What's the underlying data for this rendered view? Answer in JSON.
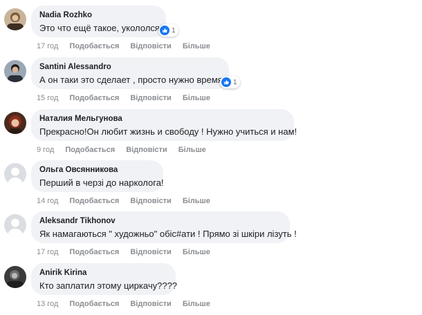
{
  "actions": {
    "like": "Подобається",
    "reply": "Відповісти",
    "more": "Більше"
  },
  "colors": {
    "bubble": "#f0f2f5",
    "like_badge": "#1877f2",
    "meta_text": "#8a8d91"
  },
  "comments": [
    {
      "author": "Nadia Rozhko",
      "text": "Это что ещё такое, укололся?",
      "time": "17 год",
      "reactions": {
        "icon": "like-icon",
        "count": "1"
      }
    },
    {
      "author": "Santini Alessandro",
      "text": "А он таки это сделает , просто нужно время !",
      "time": "15 год",
      "reactions": {
        "icon": "like-icon",
        "count": "1"
      }
    },
    {
      "author": "Наталия Мельгунова",
      "text": "Прекрасно!Он любит жизнь и свободу ! Нужно учиться и нам!",
      "time": "9 год"
    },
    {
      "author": "Ольга Овсянникова",
      "text": "Перший в черзі до нарколога!",
      "time": "14 год"
    },
    {
      "author": "Aleksandr Tikhonov",
      "text": "Як намагаються \" художньо\" обіс#ати ! Прямо зі шкіри лізуть !",
      "time": "17 год"
    },
    {
      "author": "Anirik Kirina",
      "text": "Кто заплатил этому циркачу????",
      "time": "13 год"
    }
  ]
}
